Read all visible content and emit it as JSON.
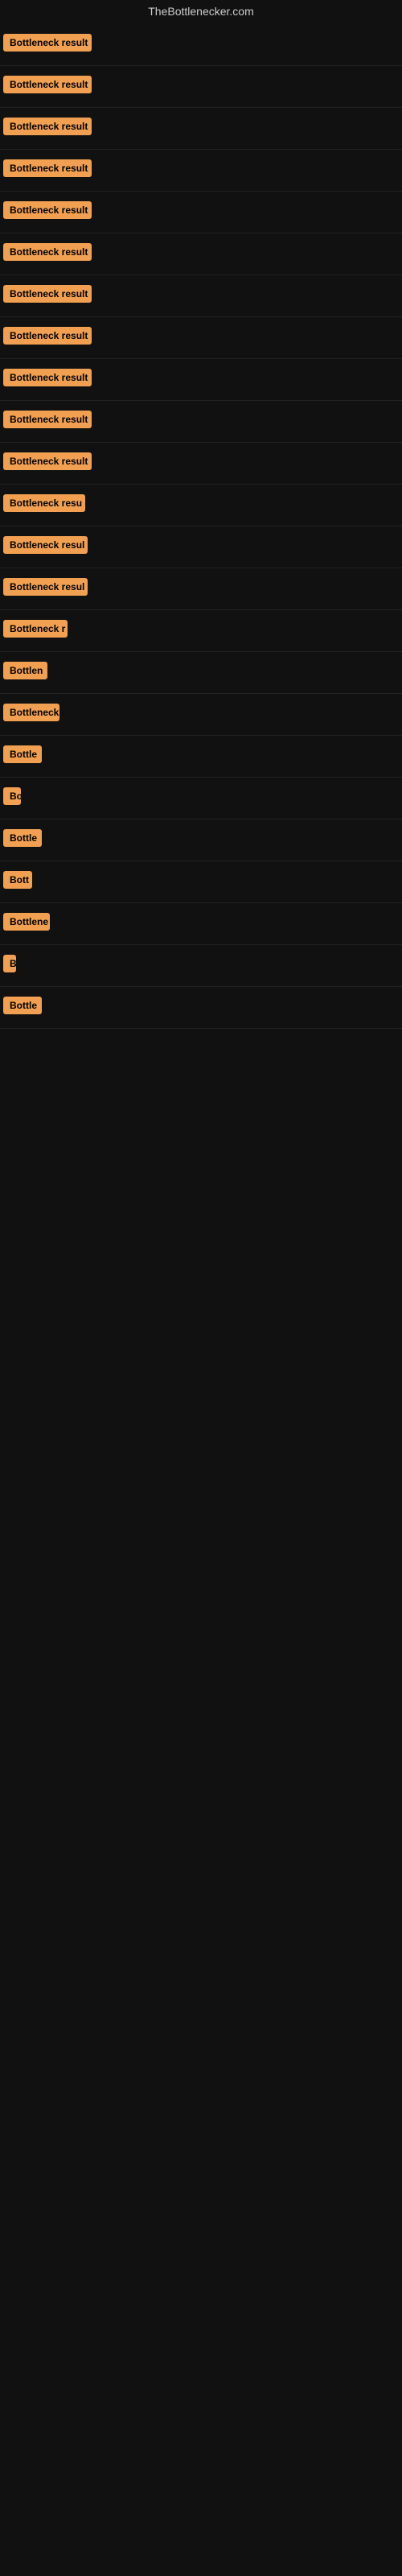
{
  "site": {
    "title": "TheBottlenecker.com"
  },
  "results": [
    {
      "id": 1,
      "label": "Bottleneck result",
      "badge_width": 110
    },
    {
      "id": 2,
      "label": "Bottleneck result",
      "badge_width": 110
    },
    {
      "id": 3,
      "label": "Bottleneck result",
      "badge_width": 110
    },
    {
      "id": 4,
      "label": "Bottleneck result",
      "badge_width": 110
    },
    {
      "id": 5,
      "label": "Bottleneck result",
      "badge_width": 110
    },
    {
      "id": 6,
      "label": "Bottleneck result",
      "badge_width": 110
    },
    {
      "id": 7,
      "label": "Bottleneck result",
      "badge_width": 110
    },
    {
      "id": 8,
      "label": "Bottleneck result",
      "badge_width": 110
    },
    {
      "id": 9,
      "label": "Bottleneck result",
      "badge_width": 110
    },
    {
      "id": 10,
      "label": "Bottleneck result",
      "badge_width": 110
    },
    {
      "id": 11,
      "label": "Bottleneck result",
      "badge_width": 110
    },
    {
      "id": 12,
      "label": "Bottleneck resu",
      "badge_width": 102
    },
    {
      "id": 13,
      "label": "Bottleneck resul",
      "badge_width": 105
    },
    {
      "id": 14,
      "label": "Bottleneck resul",
      "badge_width": 105
    },
    {
      "id": 15,
      "label": "Bottleneck r",
      "badge_width": 80
    },
    {
      "id": 16,
      "label": "Bottlen",
      "badge_width": 55
    },
    {
      "id": 17,
      "label": "Bottleneck",
      "badge_width": 70
    },
    {
      "id": 18,
      "label": "Bottle",
      "badge_width": 48
    },
    {
      "id": 19,
      "label": "Bo",
      "badge_width": 22
    },
    {
      "id": 20,
      "label": "Bottle",
      "badge_width": 48
    },
    {
      "id": 21,
      "label": "Bott",
      "badge_width": 36
    },
    {
      "id": 22,
      "label": "Bottlene",
      "badge_width": 58
    },
    {
      "id": 23,
      "label": "B",
      "badge_width": 14
    },
    {
      "id": 24,
      "label": "Bottle",
      "badge_width": 48
    }
  ]
}
